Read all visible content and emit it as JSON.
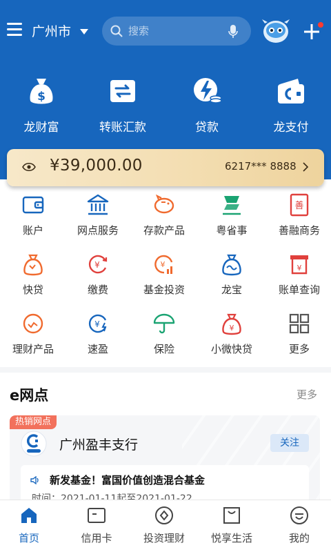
{
  "header": {
    "city": "广州市",
    "search_placeholder": "搜索"
  },
  "hero": {
    "items": [
      {
        "label": "龙财富",
        "icon": "money-bag-icon"
      },
      {
        "label": "转账汇款",
        "icon": "transfer-icon"
      },
      {
        "label": "贷款",
        "icon": "loan-icon"
      },
      {
        "label": "龙支付",
        "icon": "wallet-icon"
      }
    ]
  },
  "balance": {
    "amount": "¥39,000.00",
    "card_number": "6217*** 8888"
  },
  "services": [
    [
      {
        "label": "账户",
        "icon": "wallet-icon"
      },
      {
        "label": "网点服务",
        "icon": "bank-icon"
      },
      {
        "label": "存款产品",
        "icon": "piggy-bank-icon"
      },
      {
        "label": "粤省事",
        "icon": "yue-icon"
      },
      {
        "label": "善融商务",
        "icon": "shan-icon"
      }
    ],
    [
      {
        "label": "快贷",
        "icon": "quick-loan-icon"
      },
      {
        "label": "缴费",
        "icon": "payment-icon"
      },
      {
        "label": "基金投资",
        "icon": "fund-icon"
      },
      {
        "label": "龙宝",
        "icon": "longbao-icon"
      },
      {
        "label": "账单查询",
        "icon": "bill-icon"
      }
    ],
    [
      {
        "label": "理财产品",
        "icon": "wealth-icon"
      },
      {
        "label": "速盈",
        "icon": "suying-icon"
      },
      {
        "label": "保险",
        "icon": "umbrella-icon"
      },
      {
        "label": "小微快贷",
        "icon": "micro-loan-icon"
      },
      {
        "label": "更多",
        "icon": "grid-more-icon"
      }
    ]
  ],
  "enet": {
    "title": "e网点",
    "more": "更多",
    "tag": "热销网点",
    "branch_name": "广州盈丰支行",
    "follow": "关注",
    "notice_title": "新发基金！富国价值创造混合基金",
    "notice_time": "时间：2021-01-11起至2021-01-22"
  },
  "tabs": [
    {
      "label": "首页",
      "icon": "home-icon",
      "active": true
    },
    {
      "label": "信用卡",
      "icon": "credit-card-icon",
      "active": false
    },
    {
      "label": "投资理财",
      "icon": "investment-icon",
      "active": false
    },
    {
      "label": "悦享生活",
      "icon": "shopping-bag-icon",
      "active": false
    },
    {
      "label": "我的",
      "icon": "profile-icon",
      "active": false
    }
  ],
  "colors": {
    "primary": "#1766bd",
    "accent_orange": "#f06a2e",
    "accent_red": "#e0403c",
    "accent_green": "#1aa372",
    "gold": "#f3ddb0"
  }
}
